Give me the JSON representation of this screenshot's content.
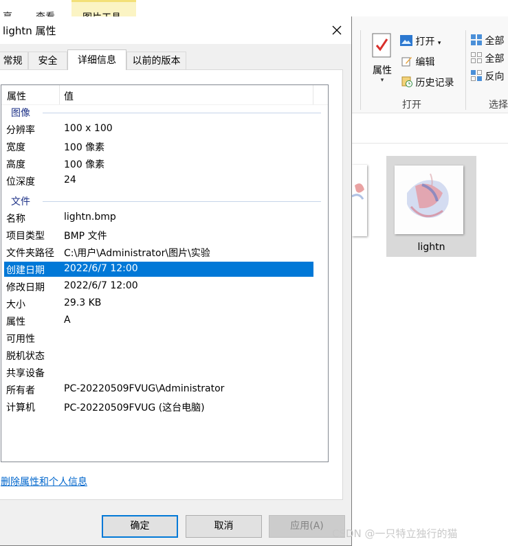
{
  "explorer": {
    "ribbon_tabs": [
      "享",
      "查看",
      "图片工具"
    ],
    "open_group": {
      "props_label": "属性",
      "open_label": "打开",
      "edit_label": "编辑",
      "history_label": "历史记录",
      "group_label": "打开"
    },
    "select_group": {
      "items": [
        "全部",
        "全部",
        "反向"
      ],
      "group_label": "选择"
    },
    "thumbnail_label": "lightn"
  },
  "dialog": {
    "title": "lightn 属性",
    "tabs": [
      "常规",
      "安全",
      "详细信息",
      "以前的版本"
    ],
    "active_tab": 2,
    "columns": {
      "name": "属性",
      "value": "值"
    },
    "groups": [
      {
        "label": "图像",
        "rows": [
          {
            "name": "分辨率",
            "value": "100 x 100"
          },
          {
            "name": "宽度",
            "value": "100 像素"
          },
          {
            "name": "高度",
            "value": "100 像素"
          },
          {
            "name": "位深度",
            "value": "24"
          }
        ]
      },
      {
        "label": "文件",
        "rows": [
          {
            "name": "名称",
            "value": "lightn.bmp"
          },
          {
            "name": "项目类型",
            "value": "BMP 文件"
          },
          {
            "name": "文件夹路径",
            "value": "C:\\用户\\Administrator\\图片\\实验"
          },
          {
            "name": "创建日期",
            "value": "2022/6/7 12:00",
            "selected": true
          },
          {
            "name": "修改日期",
            "value": "2022/6/7 12:00"
          },
          {
            "name": "大小",
            "value": "29.3 KB"
          },
          {
            "name": "属性",
            "value": "A"
          },
          {
            "name": "可用性",
            "value": ""
          },
          {
            "name": "脱机状态",
            "value": ""
          },
          {
            "name": "共享设备",
            "value": ""
          },
          {
            "name": "所有者",
            "value": "PC-20220509FVUG\\Administrator"
          },
          {
            "name": "计算机",
            "value": "PC-20220509FVUG (这台电脑)"
          }
        ]
      }
    ],
    "remove_link": "删除属性和个人信息",
    "buttons": {
      "ok": "确定",
      "cancel": "取消",
      "apply": "应用(A)"
    }
  },
  "watermark": "CSDN @一只特立独行的猫"
}
